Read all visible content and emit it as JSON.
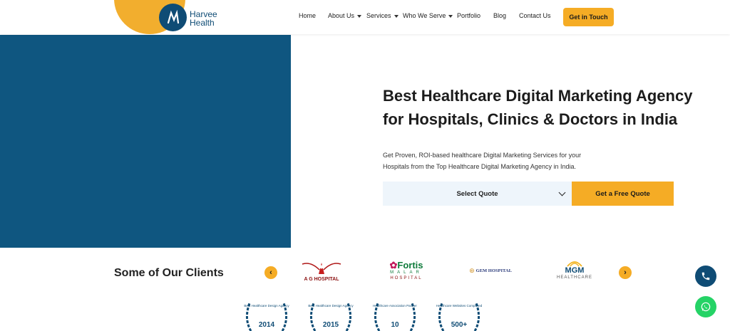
{
  "brand": {
    "line1": "Harvee",
    "line2": "Health"
  },
  "nav": {
    "items": [
      {
        "label": "Home",
        "dropdown": false
      },
      {
        "label": "About Us",
        "dropdown": true
      },
      {
        "label": "Services",
        "dropdown": true
      },
      {
        "label": "Who We Serve",
        "dropdown": true
      },
      {
        "label": "Portfolio",
        "dropdown": false
      },
      {
        "label": "Blog",
        "dropdown": false
      },
      {
        "label": "Contact Us",
        "dropdown": false
      }
    ],
    "cta": "Get in Touch"
  },
  "hero": {
    "title_line1": "Best Healthcare Digital Marketing Agency",
    "title_line2": "for Hospitals, Clinics & Doctors in India",
    "subtitle_line1": "Get Proven, ROI-based healthcare Digital Marketing Services for your",
    "subtitle_line2": "Hospitals from the Top Healthcare Digital Marketing Agency in India.",
    "select_value": "Select Quote",
    "quote_button": "Get a Free Quote"
  },
  "clients": {
    "title": "Some of Our Clients",
    "logos": [
      {
        "name": "A G HOSPITAL"
      },
      {
        "name": "Fortis",
        "sub1": "MALAR",
        "sub2": "HOSPITAL"
      },
      {
        "name": "GEM HOSPITAL"
      },
      {
        "name": "MGM",
        "sub1": "HEALTHCARE"
      }
    ]
  },
  "awards": [
    {
      "caption": "Best Healthcare Design Agency",
      "value": "2014"
    },
    {
      "caption": "Best Healthcare Design Agency",
      "value": "2015"
    },
    {
      "caption": "Healthcare Association Partner",
      "value": "10"
    },
    {
      "caption": "Healthcare Websites Completed",
      "value": "500+"
    }
  ],
  "colors": {
    "brand_blue": "#0f5680",
    "accent": "#f5ac25",
    "whatsapp": "#25d366"
  }
}
